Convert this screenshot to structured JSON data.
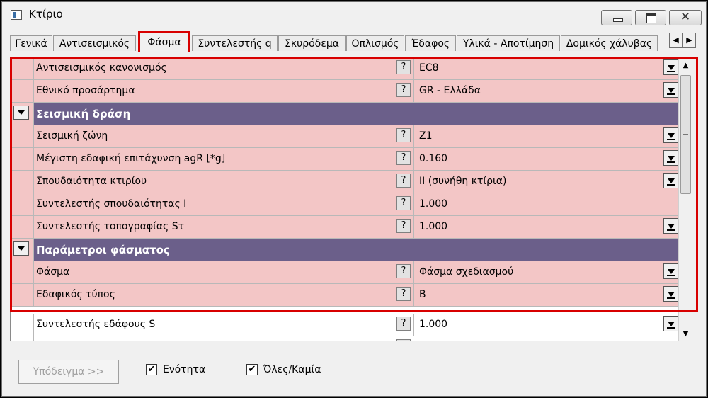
{
  "window": {
    "title": "Κτίριο"
  },
  "tabs": [
    {
      "label": "Γενικά"
    },
    {
      "label": "Αντισεισμικός"
    },
    {
      "label": "Φάσμα"
    },
    {
      "label": "Συντελεστής q"
    },
    {
      "label": "Σκυρόδεμα"
    },
    {
      "label": "Οπλισμός"
    },
    {
      "label": "Έδαφος"
    },
    {
      "label": "Υλικά - Αποτίμηση"
    },
    {
      "label": "Δομικός χάλυβας"
    }
  ],
  "active_tab": "Φάσμα",
  "help_glyph": "?",
  "rows": {
    "r0": {
      "label": "Αντισεισμικός κανονισμός",
      "value": "EC8"
    },
    "r1": {
      "label": "Εθνικό προσάρτημα",
      "value": "GR - Ελλάδα"
    },
    "s1": {
      "title": "Σεισμική δράση"
    },
    "r2": {
      "label": "Σεισμική ζώνη",
      "value": "Z1"
    },
    "r3": {
      "label": "Μέγιστη εδαφική επιτάχυνση agR [*g]",
      "value": "0.160"
    },
    "r4": {
      "label": "Σπουδαιότητα κτιρίου",
      "value": "ΙΙ (συνήθη κτίρια)"
    },
    "r5": {
      "label": "Συντελεστής  σπουδαιότητας Ι",
      "value": "1.000"
    },
    "r6": {
      "label": "Συντελεστής τοπογραφίας Sτ",
      "value": "1.000"
    },
    "s2": {
      "title": "Παράμετροι φάσματος"
    },
    "r7": {
      "label": "Φάσμα",
      "value": "Φάσμα σχεδιασμού"
    },
    "r8": {
      "label": "Εδαφικός τύπος",
      "value": "B"
    },
    "r9": {
      "label": "Συντελεστής εδάφους S",
      "value": "1.000"
    }
  },
  "footer": {
    "example_button": "Υπόδειγμα >>",
    "unit_checkbox": "Ενότητα",
    "all_none_checkbox": "Όλες/Καμία",
    "checked_glyph": "✔"
  },
  "colors": {
    "highlight": "#f3c6c6",
    "section": "#6b5f8a",
    "outline": "#d80000"
  }
}
